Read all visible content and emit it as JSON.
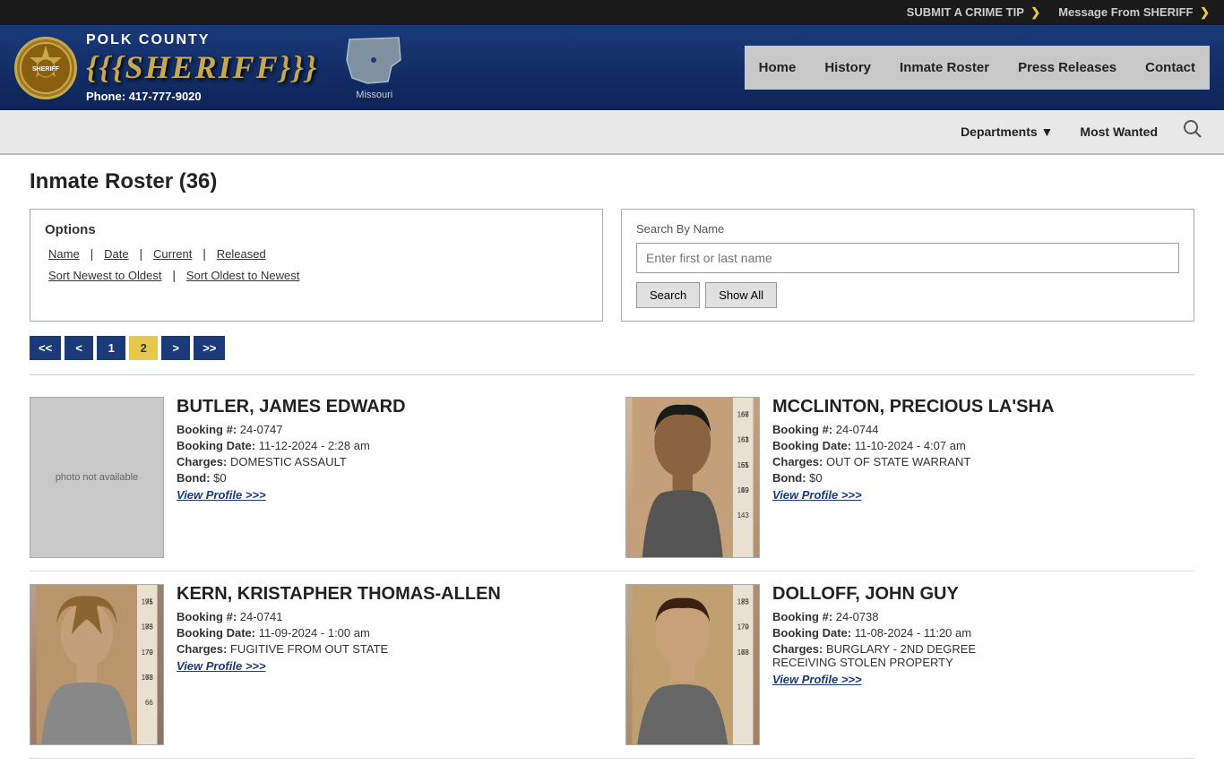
{
  "topbar": {
    "crime_tip_prefix": "SUBMIT A ",
    "crime_tip_highlight": "CRIME TIP",
    "crime_tip_chevron": "❯",
    "message_prefix": "Message From ",
    "message_highlight": "SHERIFF",
    "message_chevron": "❯"
  },
  "header": {
    "badge_text": "POLK COUNTY\nSHERIFF'S\nOFFICE",
    "county_title": "POLK COUNTY",
    "sheriff_title": "SHERIFF",
    "phone_label": "Phone:",
    "phone_number": "417-777-9020",
    "state_label": "Missouri"
  },
  "nav": {
    "items": [
      {
        "label": "Home",
        "name": "nav-home"
      },
      {
        "label": "History",
        "name": "nav-history"
      },
      {
        "label": "Inmate Roster",
        "name": "nav-inmate-roster"
      },
      {
        "label": "Press Releases",
        "name": "nav-press-releases"
      },
      {
        "label": "Contact",
        "name": "nav-contact"
      }
    ]
  },
  "subnav": {
    "departments_label": "Departments",
    "most_wanted_label": "Most Wanted"
  },
  "page": {
    "title": "Inmate Roster (36)"
  },
  "options": {
    "title": "Options",
    "name_label": "Name",
    "date_label": "Date",
    "current_label": "Current",
    "released_label": "Released",
    "sort_newest_label": "Sort Newest to Oldest",
    "sort_oldest_label": "Sort Oldest to Newest"
  },
  "search": {
    "title": "Search By Name",
    "placeholder": "Enter first or last name",
    "search_btn": "Search",
    "show_all_btn": "Show All"
  },
  "pagination": {
    "first": "<<",
    "prev": "<",
    "pages": [
      "1",
      "2"
    ],
    "active_page": "2",
    "next": ">",
    "last": ">>"
  },
  "inmates": [
    {
      "name": "BUTLER, JAMES EDWARD",
      "booking_num": "24-0747",
      "booking_date": "11-12-2024 - 2:28 am",
      "charges": "DOMESTIC ASSAULT",
      "bond": "$0",
      "view_profile": "View Profile >>>",
      "has_photo": false,
      "photo_placeholder": "photo not available"
    },
    {
      "name": "MCCLINTON, PRECIOUS LA'SHA",
      "booking_num": "24-0744",
      "booking_date": "11-10-2024 - 4:07 am",
      "charges": "OUT OF STATE WARRANT",
      "bond": "$0",
      "view_profile": "View Profile >>>",
      "has_photo": true,
      "photo_gender": "female"
    },
    {
      "name": "KERN, KRISTAPHER THOMAS-ALLEN",
      "booking_num": "24-0741",
      "booking_date": "11-09-2024 - 1:00 am",
      "charges": "FUGITIVE FROM OUT STATE",
      "bond": "",
      "view_profile": "View Profile >>>",
      "has_photo": true,
      "photo_gender": "male"
    },
    {
      "name": "DOLLOFF, JOHN GUY",
      "booking_num": "24-0738",
      "booking_date": "11-08-2024 - 11:20 am",
      "charges": "BURGLARY - 2ND DEGREE\nRECEIVING STOLEN PROPERTY",
      "bond": "",
      "view_profile": "View Profile >>>",
      "has_photo": true,
      "photo_gender": "male2"
    }
  ],
  "labels": {
    "booking_num": "Booking #:",
    "booking_date": "Booking Date:",
    "charges": "Charges:",
    "bond": "Bond:"
  }
}
